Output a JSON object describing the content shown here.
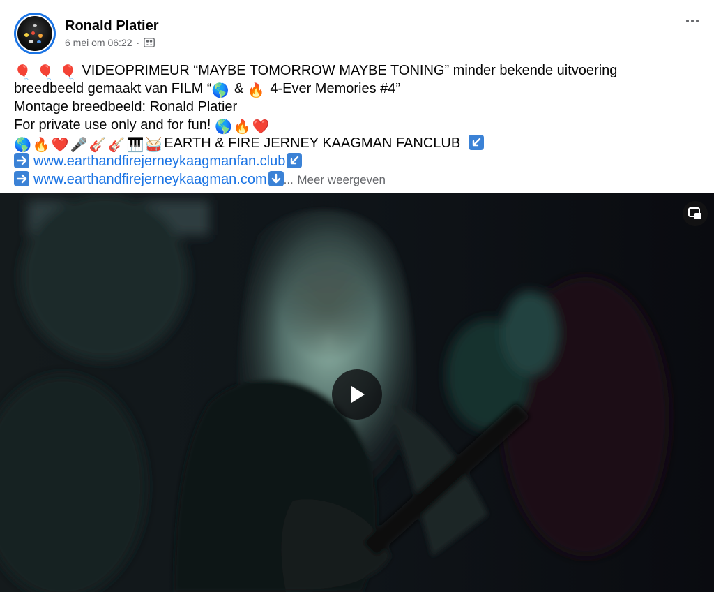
{
  "post": {
    "author": "Ronald Platier",
    "timestamp": "6 mei om 06:22",
    "separator": "·",
    "audience_icon": "friends-icon",
    "more_icon": "more-horizontal-icon"
  },
  "content": {
    "line1": "VIDEOPRIMEUR “MAYBE TOMORROW MAYBE TONING” minder bekende uitvoering",
    "line2_a": "breedbeeld gemaakt van FILM “",
    "line2_b": " & ",
    "line2_c": " 4-Ever Memories #4”",
    "line3": "Montage breedbeeld: Ronald Platier",
    "line4": "For private use only and for fun! ",
    "line5": "EARTH & FIRE JERNEY KAAGMAN FANCLUB",
    "link1": "www.earthandfirejerneykaagmanfan.club",
    "link2": "www.earthandfirejerneykaagman.com",
    "ellipsis": "...",
    "see_more": "Meer weergeven"
  },
  "emoji": {
    "balloon": "🎈",
    "globe": "🌎",
    "fire": "🔥",
    "heart": "❤️",
    "mic": "🎤",
    "guitar": "🎸",
    "piano": "🎹",
    "drum": "🥁"
  },
  "video": {
    "play_icon": "play-icon",
    "pip_icon": "picture-in-picture-icon"
  },
  "colors": {
    "link": "#1b74e4",
    "meta": "#65676b",
    "text": "#050505"
  }
}
